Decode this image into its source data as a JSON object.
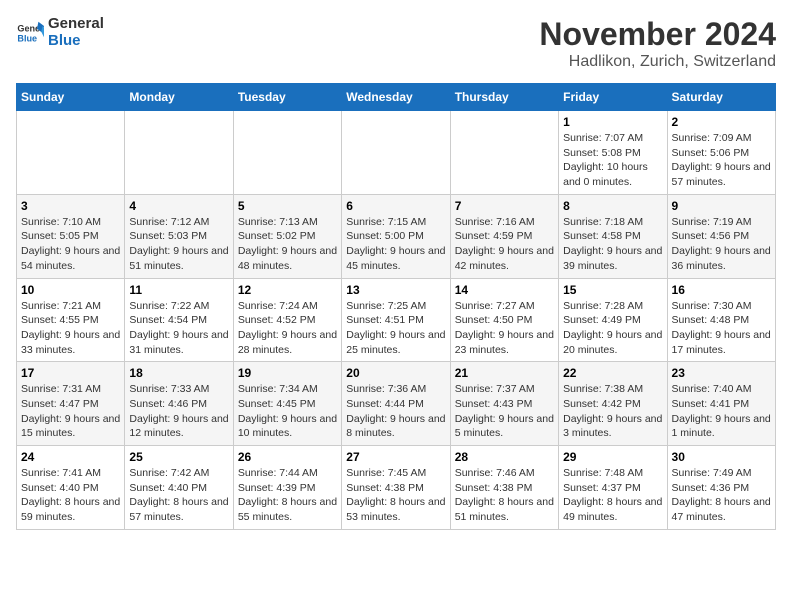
{
  "header": {
    "logo_general": "General",
    "logo_blue": "Blue",
    "month_year": "November 2024",
    "location": "Hadlikon, Zurich, Switzerland"
  },
  "calendar": {
    "days_of_week": [
      "Sunday",
      "Monday",
      "Tuesday",
      "Wednesday",
      "Thursday",
      "Friday",
      "Saturday"
    ],
    "weeks": [
      [
        {
          "day": "",
          "info": ""
        },
        {
          "day": "",
          "info": ""
        },
        {
          "day": "",
          "info": ""
        },
        {
          "day": "",
          "info": ""
        },
        {
          "day": "",
          "info": ""
        },
        {
          "day": "1",
          "info": "Sunrise: 7:07 AM\nSunset: 5:08 PM\nDaylight: 10 hours and 0 minutes."
        },
        {
          "day": "2",
          "info": "Sunrise: 7:09 AM\nSunset: 5:06 PM\nDaylight: 9 hours and 57 minutes."
        }
      ],
      [
        {
          "day": "3",
          "info": "Sunrise: 7:10 AM\nSunset: 5:05 PM\nDaylight: 9 hours and 54 minutes."
        },
        {
          "day": "4",
          "info": "Sunrise: 7:12 AM\nSunset: 5:03 PM\nDaylight: 9 hours and 51 minutes."
        },
        {
          "day": "5",
          "info": "Sunrise: 7:13 AM\nSunset: 5:02 PM\nDaylight: 9 hours and 48 minutes."
        },
        {
          "day": "6",
          "info": "Sunrise: 7:15 AM\nSunset: 5:00 PM\nDaylight: 9 hours and 45 minutes."
        },
        {
          "day": "7",
          "info": "Sunrise: 7:16 AM\nSunset: 4:59 PM\nDaylight: 9 hours and 42 minutes."
        },
        {
          "day": "8",
          "info": "Sunrise: 7:18 AM\nSunset: 4:58 PM\nDaylight: 9 hours and 39 minutes."
        },
        {
          "day": "9",
          "info": "Sunrise: 7:19 AM\nSunset: 4:56 PM\nDaylight: 9 hours and 36 minutes."
        }
      ],
      [
        {
          "day": "10",
          "info": "Sunrise: 7:21 AM\nSunset: 4:55 PM\nDaylight: 9 hours and 33 minutes."
        },
        {
          "day": "11",
          "info": "Sunrise: 7:22 AM\nSunset: 4:54 PM\nDaylight: 9 hours and 31 minutes."
        },
        {
          "day": "12",
          "info": "Sunrise: 7:24 AM\nSunset: 4:52 PM\nDaylight: 9 hours and 28 minutes."
        },
        {
          "day": "13",
          "info": "Sunrise: 7:25 AM\nSunset: 4:51 PM\nDaylight: 9 hours and 25 minutes."
        },
        {
          "day": "14",
          "info": "Sunrise: 7:27 AM\nSunset: 4:50 PM\nDaylight: 9 hours and 23 minutes."
        },
        {
          "day": "15",
          "info": "Sunrise: 7:28 AM\nSunset: 4:49 PM\nDaylight: 9 hours and 20 minutes."
        },
        {
          "day": "16",
          "info": "Sunrise: 7:30 AM\nSunset: 4:48 PM\nDaylight: 9 hours and 17 minutes."
        }
      ],
      [
        {
          "day": "17",
          "info": "Sunrise: 7:31 AM\nSunset: 4:47 PM\nDaylight: 9 hours and 15 minutes."
        },
        {
          "day": "18",
          "info": "Sunrise: 7:33 AM\nSunset: 4:46 PM\nDaylight: 9 hours and 12 minutes."
        },
        {
          "day": "19",
          "info": "Sunrise: 7:34 AM\nSunset: 4:45 PM\nDaylight: 9 hours and 10 minutes."
        },
        {
          "day": "20",
          "info": "Sunrise: 7:36 AM\nSunset: 4:44 PM\nDaylight: 9 hours and 8 minutes."
        },
        {
          "day": "21",
          "info": "Sunrise: 7:37 AM\nSunset: 4:43 PM\nDaylight: 9 hours and 5 minutes."
        },
        {
          "day": "22",
          "info": "Sunrise: 7:38 AM\nSunset: 4:42 PM\nDaylight: 9 hours and 3 minutes."
        },
        {
          "day": "23",
          "info": "Sunrise: 7:40 AM\nSunset: 4:41 PM\nDaylight: 9 hours and 1 minute."
        }
      ],
      [
        {
          "day": "24",
          "info": "Sunrise: 7:41 AM\nSunset: 4:40 PM\nDaylight: 8 hours and 59 minutes."
        },
        {
          "day": "25",
          "info": "Sunrise: 7:42 AM\nSunset: 4:40 PM\nDaylight: 8 hours and 57 minutes."
        },
        {
          "day": "26",
          "info": "Sunrise: 7:44 AM\nSunset: 4:39 PM\nDaylight: 8 hours and 55 minutes."
        },
        {
          "day": "27",
          "info": "Sunrise: 7:45 AM\nSunset: 4:38 PM\nDaylight: 8 hours and 53 minutes."
        },
        {
          "day": "28",
          "info": "Sunrise: 7:46 AM\nSunset: 4:38 PM\nDaylight: 8 hours and 51 minutes."
        },
        {
          "day": "29",
          "info": "Sunrise: 7:48 AM\nSunset: 4:37 PM\nDaylight: 8 hours and 49 minutes."
        },
        {
          "day": "30",
          "info": "Sunrise: 7:49 AM\nSunset: 4:36 PM\nDaylight: 8 hours and 47 minutes."
        }
      ]
    ]
  }
}
